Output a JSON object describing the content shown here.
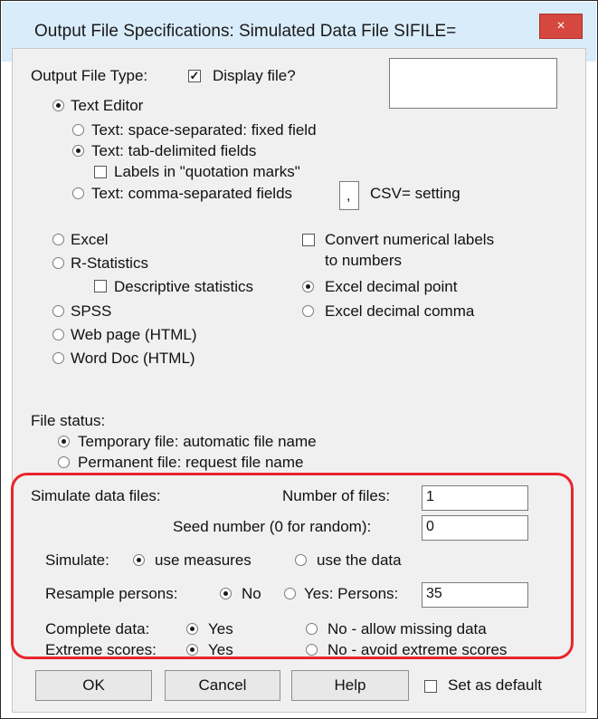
{
  "window": {
    "title": "Output File Specifications: Simulated Data File SIFILE=",
    "close_glyph": "×"
  },
  "output": {
    "type_label": "Output File Type:",
    "display_label": "Display file?",
    "text_editor": "Text Editor",
    "space_sep": "Text: space-separated: fixed field",
    "tab_delim": "Text: tab-delimited fields",
    "labels_quotes": "Labels in \"quotation marks\"",
    "comma_sep": "Text: comma-separated fields",
    "csv_value": ",",
    "csv_setting": "CSV= setting",
    "excel": "Excel",
    "r_stats": "R-Statistics",
    "desc_stats": "Descriptive statistics",
    "spss": "SPSS",
    "web_page": "Web page (HTML)",
    "word_doc": "Word Doc (HTML)",
    "convert_labels": "Convert numerical labels",
    "to_numbers": "to numbers",
    "excel_point": "Excel decimal point",
    "excel_comma": "Excel decimal comma"
  },
  "file_status": {
    "label": "File status:",
    "temporary": "Temporary file: automatic file name",
    "permanent": "Permanent file: request file name"
  },
  "simulate": {
    "label": "Simulate data files:",
    "num_files_label": "Number of files:",
    "num_files_value": "1",
    "seed_label": "Seed number (0 for random):",
    "seed_value": "0",
    "simulate_label": "Simulate:",
    "use_measures": "use measures",
    "use_data": "use the data",
    "resample_label": "Resample persons:",
    "no": "No",
    "yes_persons": "Yes: Persons:",
    "persons_value": "35",
    "complete_label": "Complete data:",
    "complete_yes": "Yes",
    "complete_no": "No - allow missing data",
    "extreme_label": "Extreme scores:",
    "extreme_yes": "Yes",
    "extreme_no": "No - avoid extreme scores"
  },
  "buttons": {
    "ok": "OK",
    "cancel": "Cancel",
    "help": "Help",
    "set_default": "Set as default"
  },
  "checkmark": "✓",
  "colors": {
    "titlebar": "#d9ecfa",
    "close": "#d5473f",
    "highlight": "#e8252c",
    "client": "#f0f0f0"
  }
}
